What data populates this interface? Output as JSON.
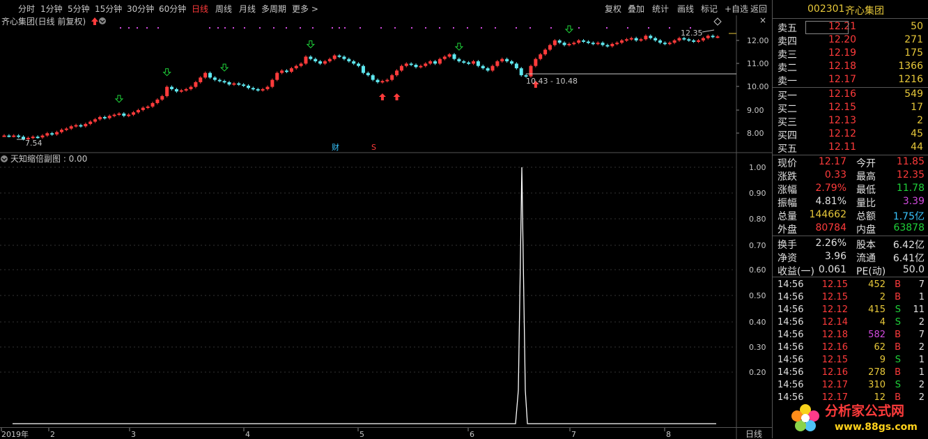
{
  "menu": {
    "items": [
      "分时",
      "1分钟",
      "5分钟",
      "15分钟",
      "30分钟",
      "60分钟",
      "日线",
      "周线",
      "月线",
      "多周期",
      "更多 >"
    ],
    "active_index": 6,
    "right_items": [
      "复权",
      "叠加",
      "统计",
      "画线",
      "标记",
      "+自选",
      "返回"
    ]
  },
  "chart": {
    "title": "齐心集团(日线 前复权)",
    "y_ticks": [
      "12.00",
      "11.00",
      "10.00",
      "9.00",
      "8.00"
    ],
    "annotation_high": "12.35",
    "annotation_low": "7.54",
    "annotation_range": "10.43 - 10.48",
    "marker_cai": "财",
    "marker_s": "S"
  },
  "sub": {
    "title": "天知缩倍副图 : 0.00",
    "y_ticks": [
      "1.00",
      "0.90",
      "0.80",
      "0.70",
      "0.60",
      "0.50",
      "0.40",
      "0.30",
      "0.20"
    ]
  },
  "xaxis": {
    "labels": [
      "2019年",
      "2",
      "3",
      "4",
      "5",
      "6",
      "7",
      "8"
    ],
    "period": "日线"
  },
  "quote": {
    "code": "002301",
    "name": "齐心集团",
    "asks": [
      {
        "label": "卖五",
        "price": "12.21",
        "vol": "50"
      },
      {
        "label": "卖四",
        "price": "12.20",
        "vol": "271"
      },
      {
        "label": "卖三",
        "price": "12.19",
        "vol": "175"
      },
      {
        "label": "卖二",
        "price": "12.18",
        "vol": "1366"
      },
      {
        "label": "卖一",
        "price": "12.17",
        "vol": "1216"
      }
    ],
    "bids": [
      {
        "label": "买一",
        "price": "12.16",
        "vol": "549"
      },
      {
        "label": "买二",
        "price": "12.15",
        "vol": "17"
      },
      {
        "label": "买三",
        "price": "12.13",
        "vol": "2"
      },
      {
        "label": "买四",
        "price": "12.12",
        "vol": "45"
      },
      {
        "label": "买五",
        "price": "12.11",
        "vol": "44"
      }
    ],
    "stats": [
      {
        "l1": "现价",
        "v1": "12.17",
        "c1": "red",
        "l2": "今开",
        "v2": "11.85",
        "c2": "red"
      },
      {
        "l1": "涨跌",
        "v1": "0.33",
        "c1": "red",
        "l2": "最高",
        "v2": "12.35",
        "c2": "red"
      },
      {
        "l1": "涨幅",
        "v1": "2.79%",
        "c1": "red",
        "l2": "最低",
        "v2": "11.78",
        "c2": "grn"
      },
      {
        "l1": "振幅",
        "v1": "4.81%",
        "c1": "wht",
        "l2": "量比",
        "v2": "3.39",
        "c2": "mag"
      },
      {
        "l1": "总量",
        "v1": "144662",
        "c1": "yel",
        "l2": "总额",
        "v2": "1.75亿",
        "c2": "cyn"
      },
      {
        "l1": "外盘",
        "v1": "80784",
        "c1": "red",
        "l2": "内盘",
        "v2": "63878",
        "c2": "grn"
      }
    ],
    "fund": [
      {
        "l1": "换手",
        "v1": "2.26%",
        "l2": "股本",
        "v2": "6.42亿"
      },
      {
        "l1": "净资",
        "v1": "3.96",
        "l2": "流通",
        "v2": "6.41亿"
      },
      {
        "l1": "收益(一)",
        "v1": "0.061",
        "l2": "PE(动)",
        "v2": "50.0"
      }
    ],
    "trades": [
      {
        "t": "14:56",
        "p": "12.15",
        "v": "452",
        "s": "B",
        "n": "7",
        "vc": "yel"
      },
      {
        "t": "14:56",
        "p": "12.15",
        "v": "2",
        "s": "B",
        "n": "1",
        "vc": "yel"
      },
      {
        "t": "14:56",
        "p": "12.12",
        "v": "415",
        "s": "S",
        "n": "11",
        "vc": "yel"
      },
      {
        "t": "14:56",
        "p": "12.14",
        "v": "4",
        "s": "S",
        "n": "2",
        "vc": "yel"
      },
      {
        "t": "14:56",
        "p": "12.18",
        "v": "582",
        "s": "B",
        "n": "7",
        "vc": "mag"
      },
      {
        "t": "14:56",
        "p": "12.16",
        "v": "62",
        "s": "B",
        "n": "2",
        "vc": "yel"
      },
      {
        "t": "14:56",
        "p": "12.15",
        "v": "9",
        "s": "S",
        "n": "1",
        "vc": "yel"
      },
      {
        "t": "14:56",
        "p": "12.16",
        "v": "278",
        "s": "B",
        "n": "1",
        "vc": "yel"
      },
      {
        "t": "14:56",
        "p": "12.17",
        "v": "310",
        "s": "S",
        "n": "2",
        "vc": "yel"
      },
      {
        "t": "14:56",
        "p": "12.17",
        "v": "12",
        "s": "B",
        "n": "2",
        "vc": "yel"
      }
    ]
  },
  "watermark": {
    "line1": "分析家公式网",
    "line2": "www.88gs.com"
  },
  "colors": {
    "up": "#ff3b3b",
    "down": "#5fe8f0",
    "arrow_down": "#1fd33a",
    "dots": "#d34be0"
  }
}
